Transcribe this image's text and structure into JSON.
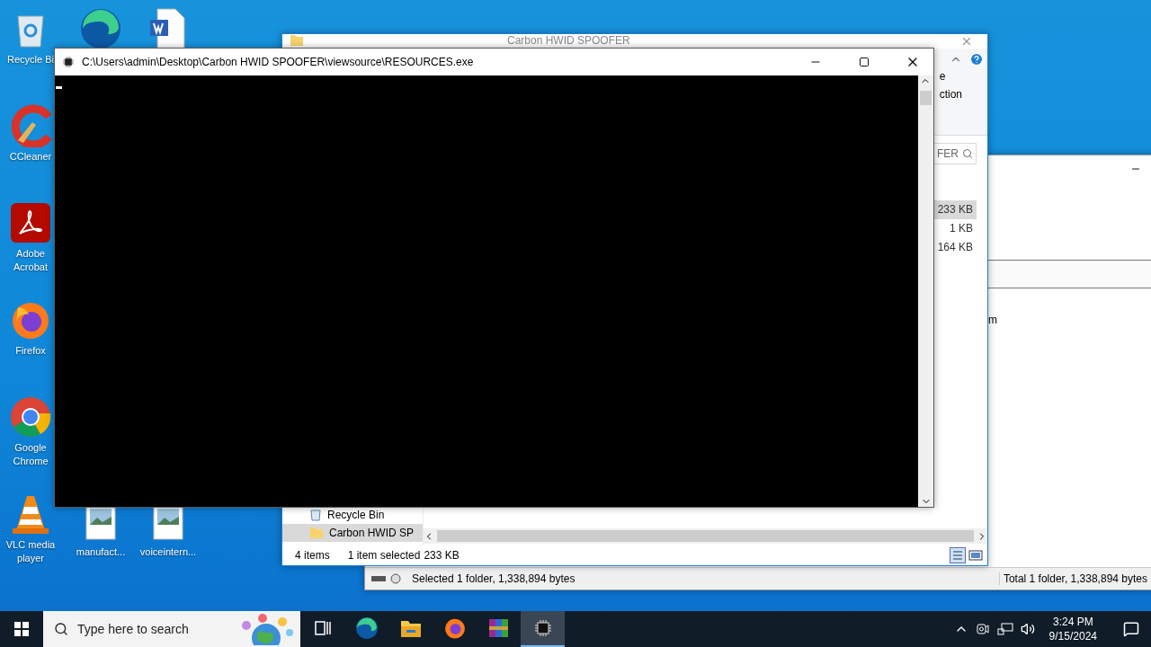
{
  "desktop": {
    "icons": [
      {
        "kind": "recycle",
        "label": "Recycle Bi"
      },
      {
        "kind": "edge"
      },
      {
        "kind": "word"
      },
      {
        "kind": "ccleaner",
        "label": "CCleaner"
      },
      {
        "kind": "acrobat",
        "label": "Adobe Acrobat"
      },
      {
        "kind": "firefox",
        "label": "Firefox"
      },
      {
        "kind": "chrome",
        "label": "Google Chrome"
      },
      {
        "kind": "vlc",
        "label": "VLC media player"
      },
      {
        "kind": "image",
        "label": "manufact..."
      },
      {
        "kind": "image",
        "label": "voiceintern..."
      }
    ]
  },
  "archive_window": {
    "column_header": "m",
    "status_left": "Selected 1 folder, 1,338,894 bytes",
    "status_right": "Total 1 folder, 1,338,894 bytes"
  },
  "explorer_window": {
    "title": "Carbon HWID SPOOFER",
    "ribbon_fragments": [
      "e",
      "ction"
    ],
    "search": {
      "placeholder": "FER"
    },
    "sizes": [
      {
        "text": "233 KB",
        "selected": true
      },
      {
        "text": "1 KB",
        "selected": false
      },
      {
        "text": "164 KB",
        "selected": false
      }
    ],
    "nav_items": [
      {
        "label": "Recycle Bin",
        "kind": "recycle",
        "selected": false
      },
      {
        "label": "Carbon HWID SP",
        "kind": "folder",
        "selected": true
      }
    ],
    "status": {
      "count": "4 items",
      "selection": "1 item selected",
      "size": "233 KB"
    }
  },
  "console_window": {
    "title": "C:\\Users\\admin\\Desktop\\Carbon HWID SPOOFER\\viewsource\\RESOURCES.exe"
  },
  "taskbar": {
    "search": {
      "placeholder": "Type here to search"
    },
    "apps": [
      {
        "kind": "taskview",
        "selected": false
      },
      {
        "kind": "edge",
        "selected": false
      },
      {
        "kind": "explorer",
        "selected": false
      },
      {
        "kind": "firefox",
        "selected": false
      },
      {
        "kind": "winrar",
        "selected": false
      },
      {
        "kind": "console",
        "selected": true
      }
    ],
    "time": "3:24 PM",
    "date": "9/15/2024"
  }
}
